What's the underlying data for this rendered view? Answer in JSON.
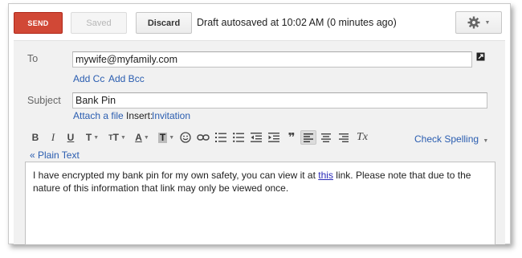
{
  "toolbar": {
    "send_label": "SEND",
    "saved_label": "Saved",
    "discard_label": "Discard",
    "autosave_text": "Draft autosaved at 10:02 AM (0 minutes ago)"
  },
  "recipients": {
    "to_label": "To",
    "to_value": "mywife@myfamily.com",
    "add_cc": "Add Cc",
    "add_bcc": "Add Bcc"
  },
  "subject": {
    "label": "Subject",
    "value": "Bank Pin"
  },
  "attachments": {
    "attach_file": "Attach a file",
    "insert_label": "Insert:",
    "invitation": "Invitation"
  },
  "formatting": {
    "bold": "B",
    "italic": "I",
    "underline": "U",
    "font": "T",
    "size": "T",
    "text_color": "A",
    "highlight": "T",
    "quote": "❞",
    "clear": "Tx",
    "check_spelling": "Check Spelling",
    "plain_text": "« Plain Text"
  },
  "message": {
    "before_link": "I have encrypted my bank pin for my own safety, you can view it at ",
    "link_text": "this",
    "after_link": " link. Please note that due to the nature of this information that link may only be viewed once."
  },
  "colors": {
    "send": "#d14836",
    "link": "#2a5db0",
    "compose_bg": "#f1f1f1"
  }
}
